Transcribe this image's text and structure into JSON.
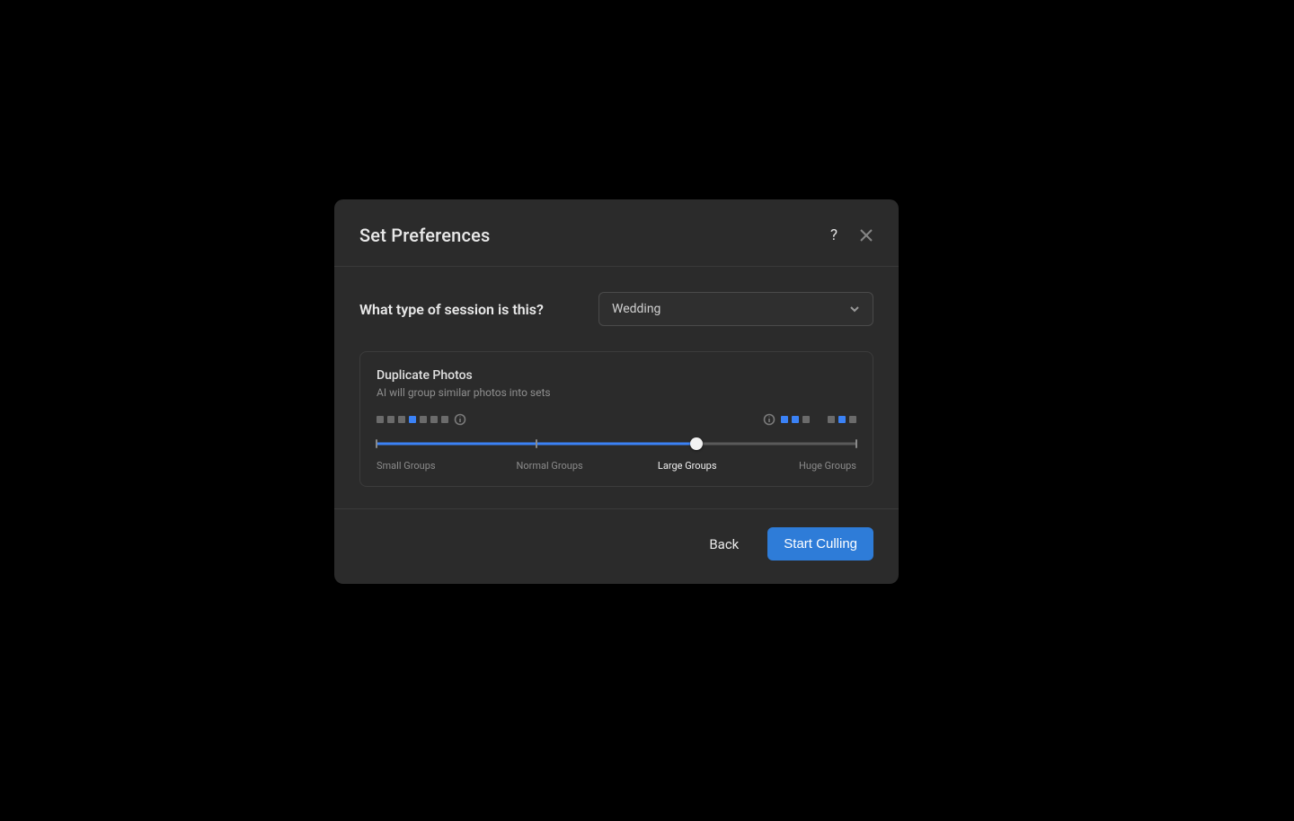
{
  "modal": {
    "title": "Set Preferences"
  },
  "session": {
    "question": "What type of session is this?",
    "selected": "Wedding"
  },
  "duplicate": {
    "title": "Duplicate Photos",
    "description": "AI will group similar photos into sets",
    "slider": {
      "min": 0,
      "max": 3,
      "value": 2,
      "labels": [
        "Small Groups",
        "Normal Groups",
        "Large Groups",
        "Huge Groups"
      ]
    }
  },
  "footer": {
    "back_label": "Back",
    "primary_label": "Start Culling"
  },
  "colors": {
    "accent": "#3b82f6",
    "panel": "#2b2b2b"
  }
}
